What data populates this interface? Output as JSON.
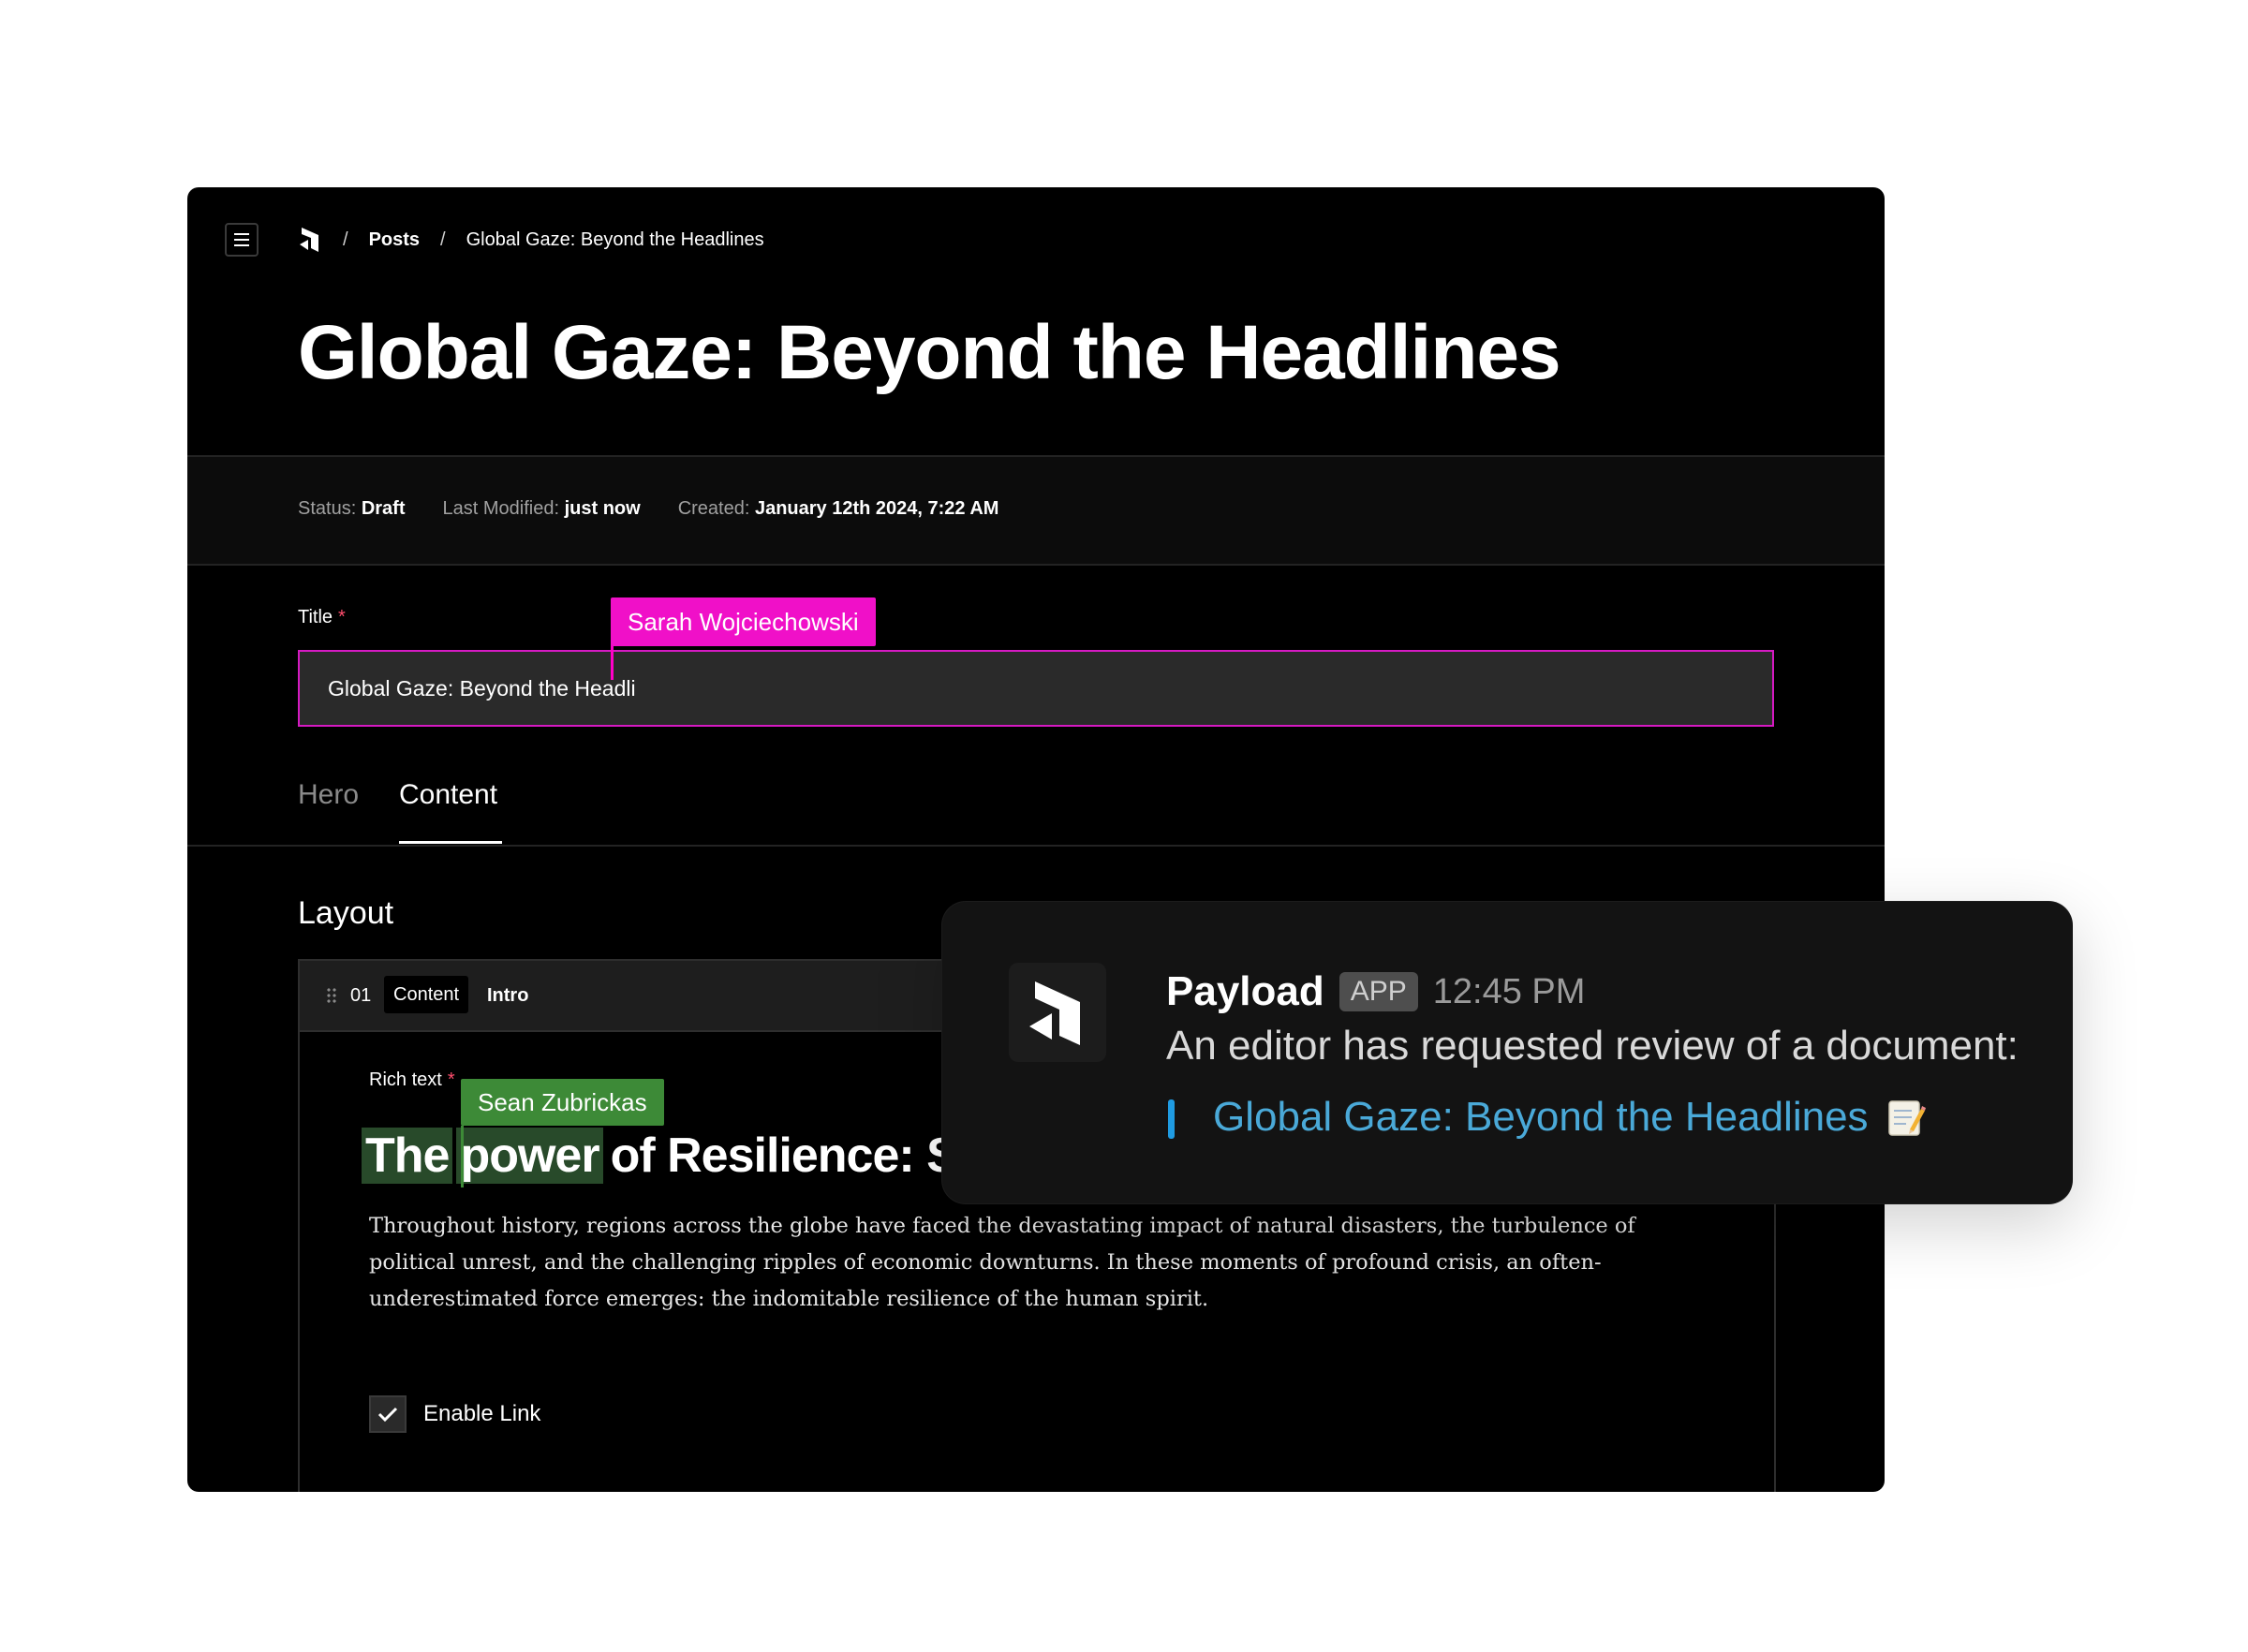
{
  "breadcrumb": {
    "posts": "Posts",
    "current": "Global Gaze: Beyond the Headlines",
    "separator": "/"
  },
  "page_title": "Global Gaze: Beyond the Headlines",
  "meta": {
    "status_label": "Status:",
    "status_value": "Draft",
    "modified_label": "Last Modified:",
    "modified_value": "just now",
    "created_label": "Created:",
    "created_value": "January 12th 2024, 7:22 AM"
  },
  "title_field": {
    "label": "Title",
    "required_mark": "*",
    "value": "Global Gaze: Beyond the Headli",
    "collaborator": "Sarah Wojciechowski",
    "collaborator_color": "#f010c8"
  },
  "tabs": [
    {
      "label": "Hero",
      "active": false
    },
    {
      "label": "Content",
      "active": true
    }
  ],
  "layout": {
    "label": "Layout",
    "block": {
      "index": "01",
      "type": "Content",
      "name": "Intro"
    }
  },
  "rich_text": {
    "label": "Rich text",
    "required_mark": "*",
    "collaborator": "Sean Zubrickas",
    "collaborator_color": "#3d8a37",
    "heading_highlight_1": "The",
    "heading_highlight_2": "power",
    "heading_rest": "of Resilience: Sto",
    "paragraph": "Throughout history, regions across the globe have faced the devastating impact of natural disasters, the turbulence of political unrest, and the challenging ripples of economic downturns. In these moments of profound crisis, an often-underestimated force emerges: the indomitable resilience of the human spirit."
  },
  "enable_link": {
    "label": "Enable Link",
    "checked": true
  },
  "notification": {
    "app_name": "Payload",
    "badge": "APP",
    "time": "12:45 PM",
    "message": "An editor has requested review of a document:",
    "link_text": "Global Gaze: Beyond the Headlines",
    "link_color": "#4aa9d8",
    "emoji_icon": "memo-icon"
  },
  "icons": {
    "menu": "hamburger-icon",
    "logo": "payload-logo-icon",
    "drag": "drag-handle-icon",
    "check": "check-icon"
  }
}
